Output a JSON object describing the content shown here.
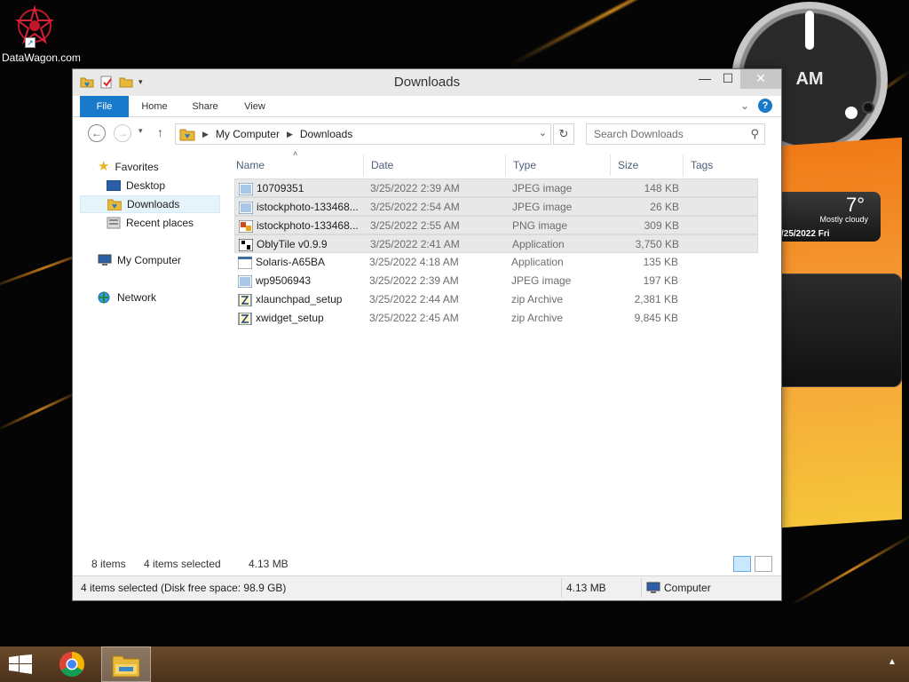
{
  "desktop": {
    "icon_label": "DataWagon.com",
    "clock_period": "AM",
    "weather": {
      "temp": "7°",
      "condition": "Mostly cloudy",
      "date": "/25/2022 Fri"
    }
  },
  "window": {
    "title": "Downloads",
    "ribbon_tabs": [
      "File",
      "Home",
      "Share",
      "View"
    ],
    "help_label": "?",
    "address": {
      "root": "My Computer",
      "current": "Downloads"
    },
    "search_placeholder": "Search Downloads",
    "nav": {
      "favorites": "Favorites",
      "desktop": "Desktop",
      "downloads": "Downloads",
      "recent": "Recent places",
      "computer": "My Computer",
      "network": "Network"
    },
    "columns": {
      "name": "Name",
      "date": "Date",
      "type": "Type",
      "size": "Size",
      "tags": "Tags"
    },
    "files": [
      {
        "name": "10709351",
        "date": "3/25/2022 2:39 AM",
        "type": "JPEG image",
        "size": "148 KB",
        "icon": "image-icon",
        "selected": true
      },
      {
        "name": "istockphoto-133468...",
        "date": "3/25/2022 2:54 AM",
        "type": "JPEG image",
        "size": "26 KB",
        "icon": "image-icon",
        "selected": true
      },
      {
        "name": "istockphoto-133468...",
        "date": "3/25/2022 2:55 AM",
        "type": "PNG image",
        "size": "309 KB",
        "icon": "png-icon",
        "selected": true
      },
      {
        "name": "OblyTile v0.9.9",
        "date": "3/25/2022 2:41 AM",
        "type": "Application",
        "size": "3,750 KB",
        "icon": "app-icon",
        "selected": true
      },
      {
        "name": "Solaris-A65BA",
        "date": "3/25/2022 4:18 AM",
        "type": "Application",
        "size": "135 KB",
        "icon": "app-window-icon",
        "selected": false
      },
      {
        "name": "wp9506943",
        "date": "3/25/2022 2:39 AM",
        "type": "JPEG image",
        "size": "197 KB",
        "icon": "image-icon",
        "selected": false
      },
      {
        "name": "xlaunchpad_setup",
        "date": "3/25/2022 2:44 AM",
        "type": "zip Archive",
        "size": "2,381 KB",
        "icon": "zip-icon",
        "selected": false
      },
      {
        "name": "xwidget_setup",
        "date": "3/25/2022 2:45 AM",
        "type": "zip Archive",
        "size": "9,845 KB",
        "icon": "zip-icon",
        "selected": false
      }
    ],
    "status": {
      "items": "8 items",
      "selected": "4 items selected",
      "size": "4.13 MB"
    },
    "bottom": {
      "info": "4 items selected (Disk free space: 98.9 GB)",
      "size": "4.13 MB",
      "location": "Computer"
    }
  },
  "colors": {
    "accent": "#1979ca",
    "selection": "#e8e8e8",
    "taskbar": "#5a3d22"
  }
}
